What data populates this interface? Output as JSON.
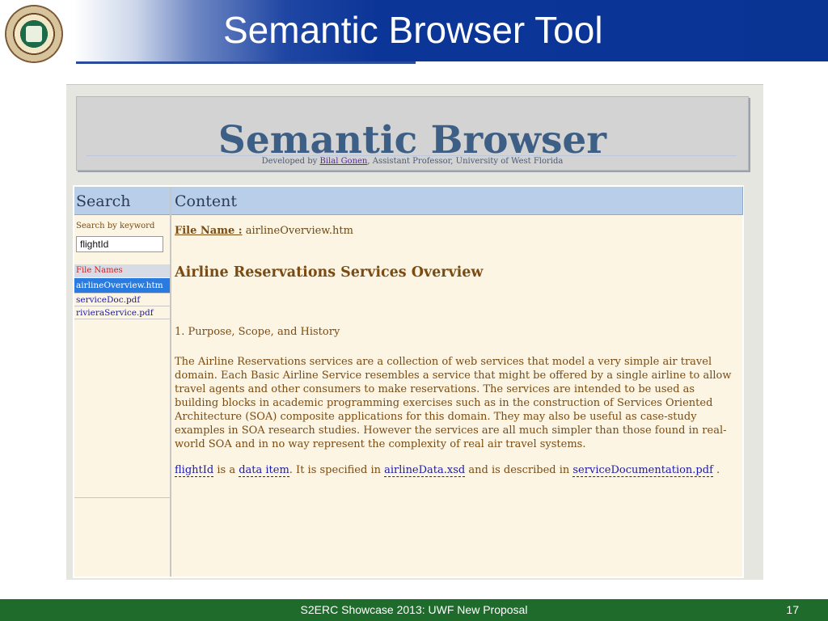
{
  "slide": {
    "title": "Semantic Browser Tool",
    "footer": "S2ERC Showcase 2013: UWF New Proposal",
    "page_number": "17",
    "logo_icon": "university-seal-icon"
  },
  "banner": {
    "title": "Semantic Browser",
    "developed_by": "Developed by ",
    "author_link": "Bilal Gonen",
    "affiliation": ", Assistant Professor, University of West Florida"
  },
  "search": {
    "heading": "Search",
    "keyword_label": "Search by keyword",
    "keyword_value": "flightId",
    "files_heading": "File Names",
    "files": [
      "airlineOverview.htm",
      "serviceDoc.pdf",
      "rivieraService.pdf"
    ],
    "selected_index": 0
  },
  "content": {
    "heading": "Content",
    "file_name_label": "File Name :",
    "file_name_value": " airlineOverview.htm",
    "doc_title": "Airline Reservations Services Overview",
    "section": "1. Purpose, Scope, and History",
    "paragraph": "The Airline Reservations services are a collection of web services that model a very simple air travel domain. Each Basic Airline Service resembles a service that might be offered by a single airline to allow travel agents and other consumers to make reservations. The services are intended to be used as building blocks in academic programming exercises such as in the construction of Services Oriented Architecture (SOA) composite applications for this domain. They may also be useful as case-study examples in SOA research studies. However the services are all much simpler than those found in real-world SOA and in no way represent the complexity of real air travel systems.",
    "result": {
      "term": "flightId",
      "t1": " is a ",
      "type_link": "data item",
      "t2": ". It is specified in ",
      "spec_link": "airlineData.xsd",
      "t3": " and is described in ",
      "doc_link": "serviceDocumentation.pdf",
      "t4": " ."
    }
  },
  "colors": {
    "header_blue": "#0a3494",
    "footer_green": "#1f6b2c",
    "panel_header": "#b9cfe9",
    "panel_bg": "#fdf5e3",
    "text_brown": "#7a4b12",
    "link_blue": "#1a1aa8",
    "selected_blue": "#2a7be0"
  }
}
